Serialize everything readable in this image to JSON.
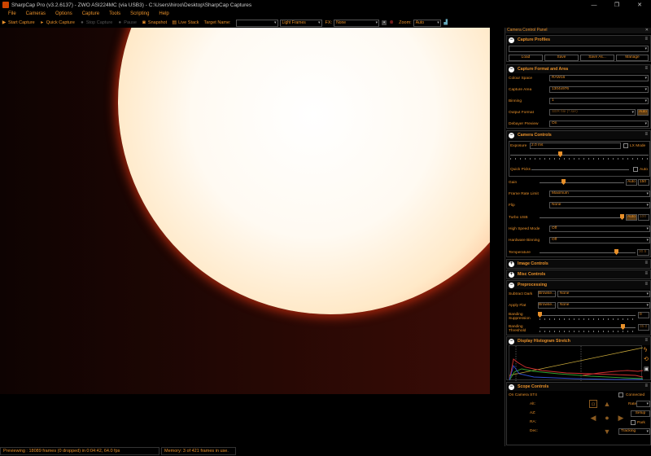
{
  "window": {
    "title": "SharpCap Pro (v3.2.6137) - ZWO ASI224MC (via USB3) - C:\\Users\\hiroo\\Desktop\\SharpCap Captures",
    "controls": [
      "—",
      "❐",
      "✕"
    ]
  },
  "menu": [
    "File",
    "Cameras",
    "Options",
    "Capture",
    "Tools",
    "Scripting",
    "Help"
  ],
  "toolbar": {
    "start_capture": "Start Capture",
    "quick_capture": "Quick Capture",
    "stop_capture": "Stop Capture",
    "pause": "Pause",
    "snapshot": "Snapshot",
    "live_stack": "Live Stack",
    "target_name_label": "Target Name:",
    "target_name_value": "",
    "frame_type": "Light Frames",
    "fx_label": "FX:",
    "fx_value": "None",
    "zoom_label": "Zoom:",
    "zoom_value": "Auto"
  },
  "status": {
    "preview": "Previewing : 18089 frames (0 dropped) in 0:04:42, 64.0 fps",
    "memory": "Memory: 3 of 421 frames in use."
  },
  "panel": {
    "title": "Camera Control Panel",
    "capture_profiles": {
      "header": "Capture Profiles",
      "buttons": [
        "Load",
        "Save",
        "Save As...",
        "Manage"
      ]
    },
    "capture_format": {
      "header": "Capture Format and Area",
      "colour_space_label": "Colour Space",
      "colour_space": "RAW16",
      "capture_area_label": "Capture Area",
      "capture_area": "1304x976",
      "binning_label": "Binning",
      "binning": "1",
      "output_format_label": "Output Format",
      "output_format": "SER file (*.ser)",
      "output_auto": "Auto",
      "debayer_label": "Debayer Preview",
      "debayer": "On"
    },
    "camera_controls": {
      "header": "Camera Controls",
      "exposure_label": "Exposure",
      "exposure_value": "2.0 ms",
      "lx_mode": "LX Mode",
      "quick_picks": "Quick Picks",
      "auto": "Auto",
      "gain_label": "Gain",
      "gain_auto": "Auto",
      "gain_value": "150",
      "frame_rate_label": "Frame Rate Limit",
      "frame_rate": "Maximum",
      "flip_label": "Flip",
      "flip": "None",
      "turbo_label": "Turbo USB",
      "turbo_auto": "Auto",
      "turbo_value": "100",
      "highspeed_label": "High Speed Mode",
      "highspeed": "Off",
      "hwbin_label": "Hardware Binning",
      "hwbin": "Off",
      "temp_label": "Temperature",
      "temp_value": "30.5"
    },
    "image_controls": {
      "header": "Image Controls"
    },
    "misc_controls": {
      "header": "Misc Controls"
    },
    "preprocessing": {
      "header": "Preprocessing",
      "subtract_dark_label": "Subtract Dark",
      "browse": "Browse...",
      "subtract_dark": "None",
      "apply_flat_label": "Apply Flat",
      "apply_flat": "None",
      "banding_supp_label": "Banding Suppression",
      "banding_supp_value": "0",
      "banding_thresh_label": "Banding Threshold",
      "banding_thresh_value": "35.0"
    },
    "histogram": {
      "header": "Display Histogram Stretch"
    },
    "scope": {
      "header": "Scope Controls",
      "mount": "On Camera ST4",
      "connected": "Connected",
      "labels": [
        "Alt:",
        "AZ:",
        "RA:",
        "Dec:"
      ],
      "rate_label": "Rate",
      "setup": "Setup",
      "park": "Park",
      "tracking": "Tracking"
    }
  }
}
